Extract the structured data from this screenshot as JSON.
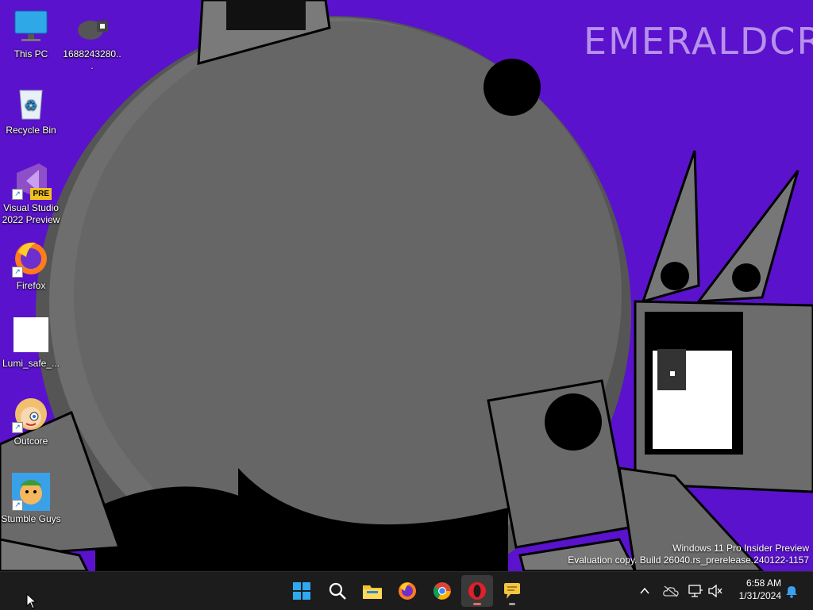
{
  "desktop": {
    "icons": [
      {
        "label": "This PC",
        "icon": "monitor-icon"
      },
      {
        "label": "1688243280...",
        "icon": "image-file-icon"
      },
      {
        "label": "Recycle Bin",
        "icon": "recycle-bin-icon"
      },
      {
        "label": "Visual Studio 2022 Preview",
        "icon": "visual-studio-icon",
        "badge": "PRE"
      },
      {
        "label": "Firefox",
        "icon": "firefox-icon"
      },
      {
        "label": "Lumi_safe_...",
        "icon": "blank-file-icon"
      },
      {
        "label": "Outcore",
        "icon": "outcore-icon"
      },
      {
        "label": "Stumble Guys",
        "icon": "stumble-guys-icon"
      }
    ],
    "wallpaper": {
      "text": "EMERALDCRAFTS",
      "background": "#5a12cc"
    }
  },
  "watermark": {
    "line1": "Windows 11 Pro Insider Preview",
    "line2": "Evaluation copy. Build 26040.rs_prerelease.240122-1157"
  },
  "taskbar": {
    "apps": [
      {
        "name": "Start",
        "icon": "windows-start-icon"
      },
      {
        "name": "Search",
        "icon": "search-icon"
      },
      {
        "name": "File Explorer",
        "icon": "folder-icon"
      },
      {
        "name": "Firefox",
        "icon": "firefox-icon"
      },
      {
        "name": "Chrome",
        "icon": "chrome-icon"
      },
      {
        "name": "Opera",
        "icon": "opera-icon",
        "active": true
      },
      {
        "name": "Chat",
        "icon": "chat-bubble-icon"
      }
    ],
    "tray": {
      "icons": [
        "chevron-up-icon",
        "cloud-offline-icon",
        "network-icon",
        "speaker-muted-icon",
        "notification-bell-icon"
      ]
    },
    "clock": {
      "time": "6:58 AM",
      "date": "1/31/2024"
    }
  }
}
